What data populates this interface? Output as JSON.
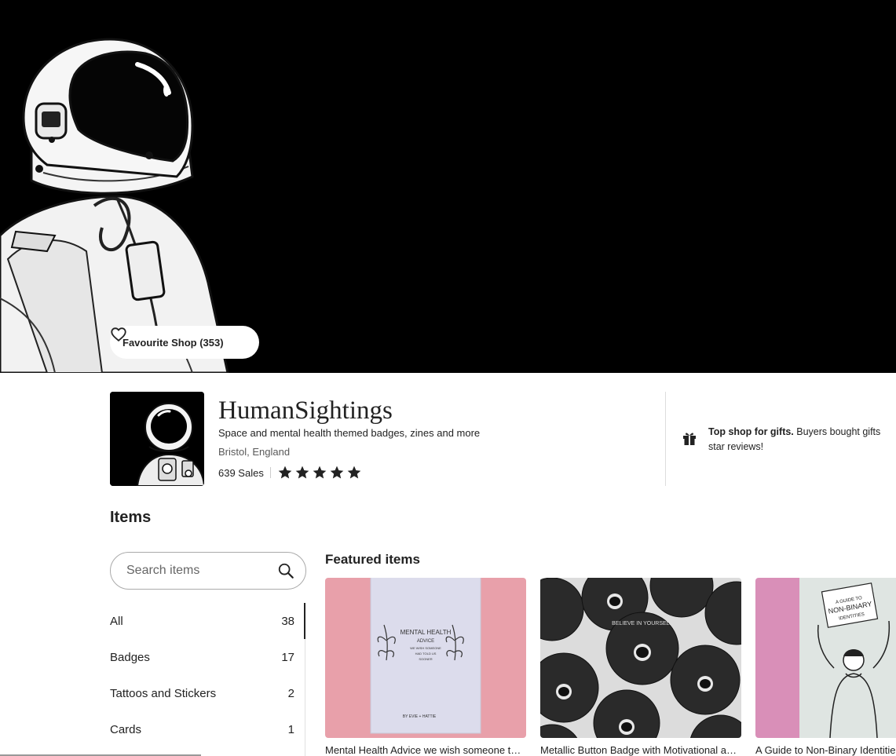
{
  "banner": {
    "favourite_label": "Favourite Shop (353)"
  },
  "shop": {
    "name": "HumanSightings",
    "tagline": "Space and mental health themed badges, zines and more",
    "location": "Bristol, England",
    "sales": "639 Sales",
    "rating_stars": 5,
    "gift_bold": "Top shop for gifts.",
    "gift_line1": " Buyers bought gifts",
    "gift_line2": "star reviews!"
  },
  "items": {
    "heading": "Items",
    "search_placeholder": "Search items",
    "categories": [
      {
        "label": "All",
        "count": "38"
      },
      {
        "label": "Badges",
        "count": "17"
      },
      {
        "label": "Tattoos and Stickers",
        "count": "2"
      },
      {
        "label": "Cards",
        "count": "1"
      }
    ]
  },
  "featured": {
    "heading": "Featured items",
    "cards": [
      {
        "title": "Mental Health Advice we wish someone told us sooner zine"
      },
      {
        "title": "Metallic Button Badge with Motivational astronaut design"
      },
      {
        "title": "A Guide to Non-Binary Identities zine"
      }
    ],
    "zine1_text": [
      "MENTAL HEALTH",
      "ADVICE",
      "WE WISH SOMEONE",
      "HAD TOLD US",
      "SOONER",
      "BY EVIE + HATTIE"
    ],
    "zine3_text": [
      "A GUIDE TO",
      "NON-BINARY",
      "IDENTITIES"
    ],
    "badge_text": "BELIEVE IN YOURSELF"
  },
  "colors": {
    "banner_bg": "#000000",
    "card1_bg": "#e8a0aa",
    "card3_bg": "#d98fb8",
    "text": "#222222"
  }
}
